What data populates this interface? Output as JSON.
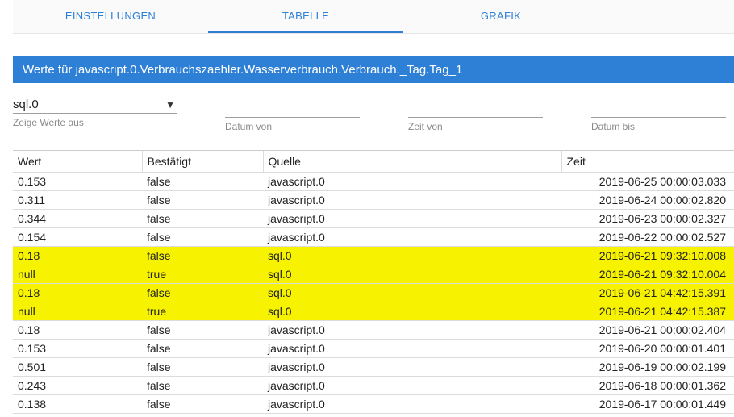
{
  "tabs": [
    {
      "label": "EINSTELLUNGEN",
      "active": false
    },
    {
      "label": "TABELLE",
      "active": true
    },
    {
      "label": "GRAFIK",
      "active": false
    }
  ],
  "title": "Werte für javascript.0.Verbrauchszaehler.Wasserverbrauch.Verbrauch._Tag.Tag_1",
  "filters": {
    "source": {
      "value": "sql.0",
      "label": "Zeige Werte aus"
    },
    "date_from": {
      "value": "",
      "label": "Datum von"
    },
    "time_from": {
      "value": "",
      "label": "Zeit von"
    },
    "date_to": {
      "value": "",
      "label": "Datum bis"
    }
  },
  "columns": {
    "wert": "Wert",
    "bestaetigt": "Bestätigt",
    "quelle": "Quelle",
    "zeit": "Zeit"
  },
  "rows": [
    {
      "wert": "0.153",
      "bestaetigt": "false",
      "quelle": "javascript.0",
      "zeit": "2019-06-25 00:00:03.033",
      "hl": false
    },
    {
      "wert": "0.311",
      "bestaetigt": "false",
      "quelle": "javascript.0",
      "zeit": "2019-06-24 00:00:02.820",
      "hl": false
    },
    {
      "wert": "0.344",
      "bestaetigt": "false",
      "quelle": "javascript.0",
      "zeit": "2019-06-23 00:00:02.327",
      "hl": false
    },
    {
      "wert": "0.154",
      "bestaetigt": "false",
      "quelle": "javascript.0",
      "zeit": "2019-06-22 00:00:02.527",
      "hl": false
    },
    {
      "wert": "0.18",
      "bestaetigt": "false",
      "quelle": "sql.0",
      "zeit": "2019-06-21 09:32:10.008",
      "hl": true
    },
    {
      "wert": "null",
      "bestaetigt": "true",
      "quelle": "sql.0",
      "zeit": "2019-06-21 09:32:10.004",
      "hl": true
    },
    {
      "wert": "0.18",
      "bestaetigt": "false",
      "quelle": "sql.0",
      "zeit": "2019-06-21 04:42:15.391",
      "hl": true
    },
    {
      "wert": "null",
      "bestaetigt": "true",
      "quelle": "sql.0",
      "zeit": "2019-06-21 04:42:15.387",
      "hl": true
    },
    {
      "wert": "0.18",
      "bestaetigt": "false",
      "quelle": "javascript.0",
      "zeit": "2019-06-21 00:00:02.404",
      "hl": false
    },
    {
      "wert": "0.153",
      "bestaetigt": "false",
      "quelle": "javascript.0",
      "zeit": "2019-06-20 00:00:01.401",
      "hl": false
    },
    {
      "wert": "0.501",
      "bestaetigt": "false",
      "quelle": "javascript.0",
      "zeit": "2019-06-19 00:00:02.199",
      "hl": false
    },
    {
      "wert": "0.243",
      "bestaetigt": "false",
      "quelle": "javascript.0",
      "zeit": "2019-06-18 00:00:01.362",
      "hl": false
    },
    {
      "wert": "0.138",
      "bestaetigt": "false",
      "quelle": "javascript.0",
      "zeit": "2019-06-17 00:00:01.449",
      "hl": false
    }
  ]
}
